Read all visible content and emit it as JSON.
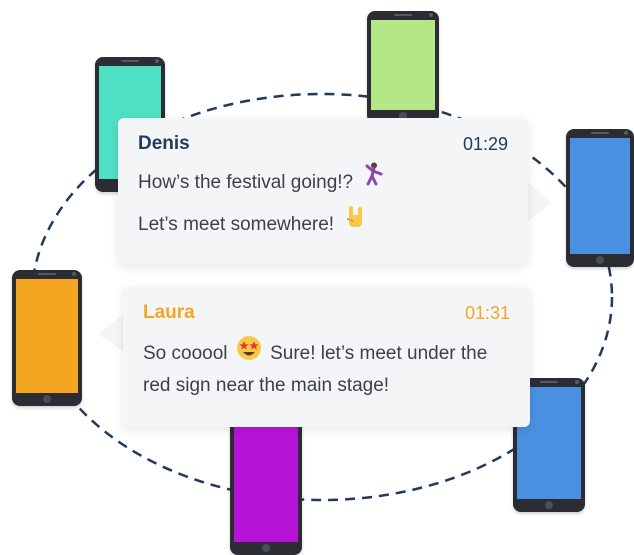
{
  "colors": {
    "phone_body": "#2b2d33",
    "path_stroke": "#1f3a5c",
    "bubble_bg": "#f4f5f7",
    "denis_name": "#1f3a5c",
    "laura_accent": "#f4a623",
    "message_text": "#3c4148"
  },
  "phones": [
    {
      "screen_color": "#4fe0c3"
    },
    {
      "screen_color": "#b4e886"
    },
    {
      "screen_color": "#4a90e2"
    },
    {
      "screen_color": "#f4a623"
    },
    {
      "screen_color": "#4a90e2"
    },
    {
      "screen_color": "#b814d9"
    }
  ],
  "messages": [
    {
      "sender": "Denis",
      "time": "01:29",
      "lines": [
        "How’s the festival going!?",
        "Let’s meet somewhere!"
      ],
      "emojis": [
        "dancing-person-icon",
        "rock-on-hand-icon"
      ]
    },
    {
      "sender": "Laura",
      "time": "01:31",
      "line1_before": "So cooool",
      "line1_after": "Sure! let’s meet under the",
      "line2": "red sign near the main stage!",
      "emojis": [
        "star-struck-face-icon"
      ]
    }
  ]
}
